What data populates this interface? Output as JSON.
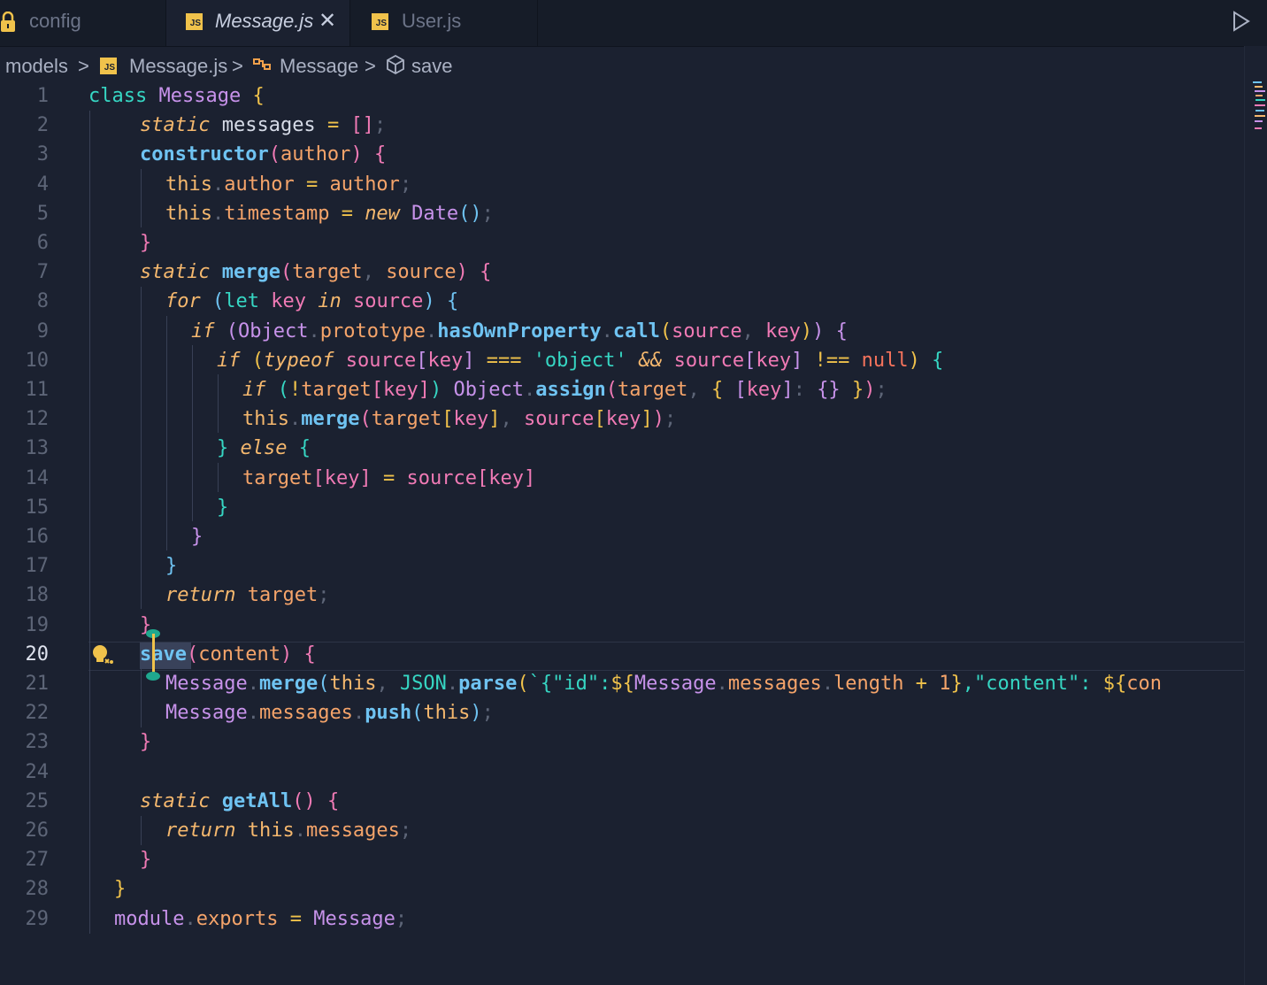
{
  "tabs": [
    {
      "label": "config",
      "icon": "lock-icon",
      "active": false
    },
    {
      "label": "Message.js",
      "icon": "js-file-icon",
      "active": true,
      "close": "✕"
    },
    {
      "label": "User.js",
      "icon": "js-file-icon",
      "active": false
    }
  ],
  "js_icon_text": "JS",
  "breadcrumb": {
    "folder": "models",
    "file": "Message.js",
    "class": "Message",
    "method": "save",
    "separator": ">"
  },
  "editor": {
    "current_line": 20,
    "line_numbers": [
      "1",
      "2",
      "3",
      "4",
      "5",
      "6",
      "7",
      "8",
      "9",
      "10",
      "11",
      "12",
      "13",
      "14",
      "15",
      "16",
      "17",
      "18",
      "19",
      "20",
      "21",
      "22",
      "23",
      "24",
      "25",
      "26",
      "27",
      "28",
      "29"
    ]
  },
  "colors": {
    "background": "#1b2130",
    "keyword": "#f5b86e",
    "class": "#c792ea",
    "function": "#6fc3f2",
    "string": "#36d6c3",
    "accent": "#f0c24b"
  }
}
